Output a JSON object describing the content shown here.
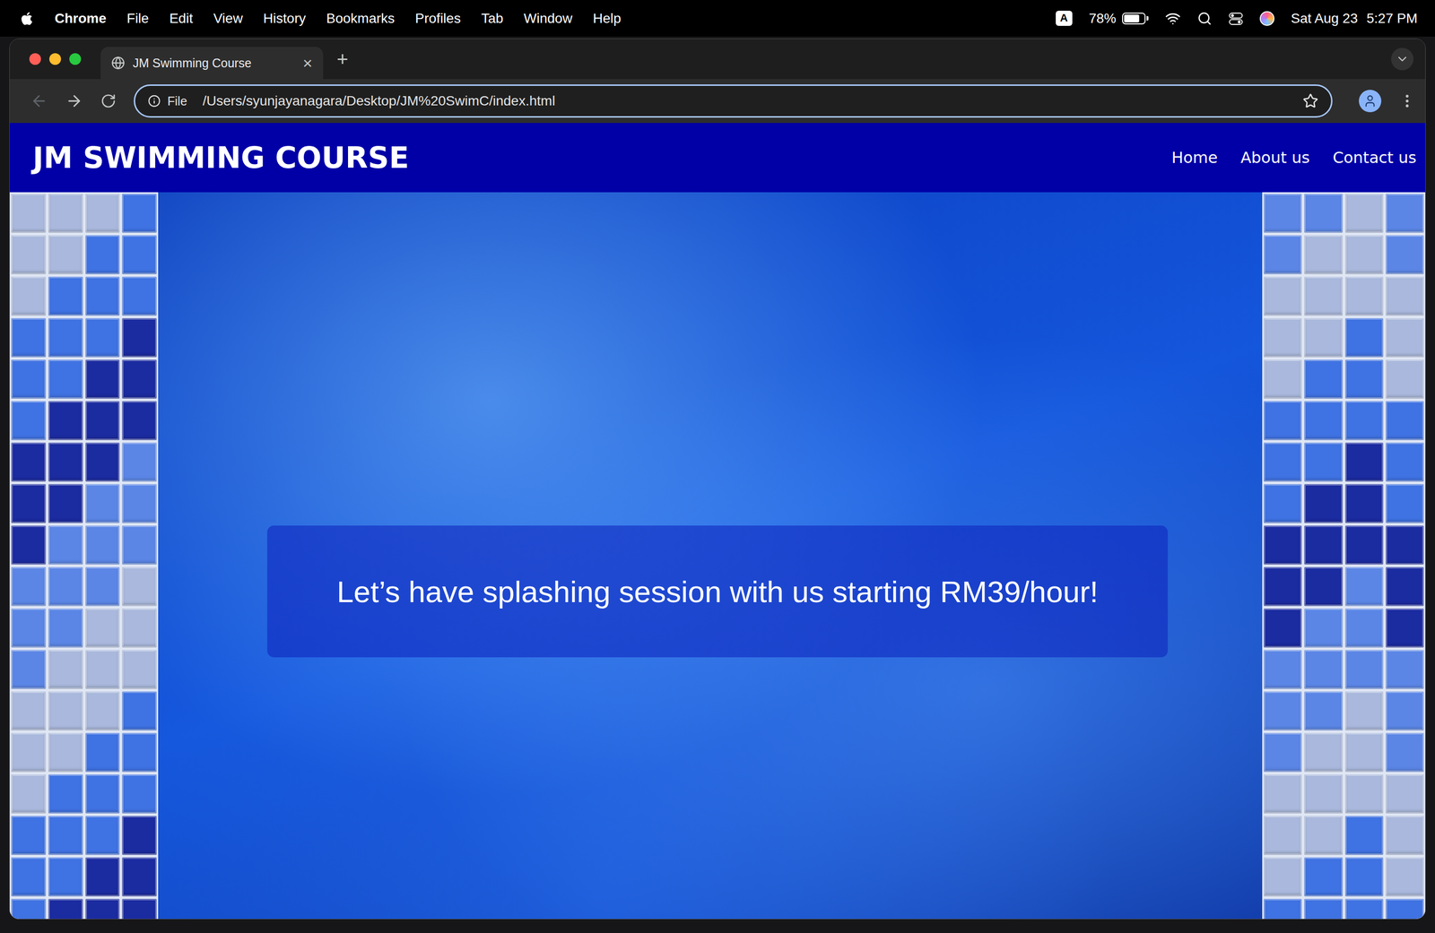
{
  "menu_bar": {
    "app": "Chrome",
    "items": [
      "File",
      "Edit",
      "View",
      "History",
      "Bookmarks",
      "Profiles",
      "Tab",
      "Window",
      "Help"
    ],
    "input_source": "A",
    "battery": {
      "reading": "78%",
      "level": 0.78
    },
    "date": "Sat Aug 23",
    "time": "5:27 PM"
  },
  "browser": {
    "tabs": [
      {
        "label": "JM Swimming Course",
        "selected": true,
        "close": "×"
      }
    ],
    "new_tab": "+",
    "back_enabled": false,
    "forward_enabled": true,
    "address": {
      "scheme": "File",
      "url": "/Users/syunjayanagara/Desktop/JM%20SwimC/index.html"
    }
  },
  "page": {
    "brand": "JM SWIMMING COURSE",
    "nav": [
      {
        "label": "Home"
      },
      {
        "label": "About us"
      },
      {
        "label": "Contact us"
      }
    ],
    "hero": {
      "tagline": "Let’s have splashing session with us starting RM39/hour!"
    }
  }
}
